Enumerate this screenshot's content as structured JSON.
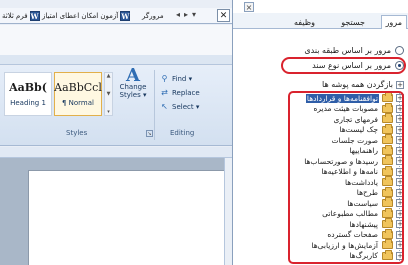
{
  "word": {
    "taskbar_tabs": [
      {
        "label": "فرم ثلاثة"
      },
      {
        "label": "آزمون امکان اعطای امتیاز"
      },
      {
        "label": "مرورگر"
      }
    ],
    "nav_arrows": [
      "◂",
      "▸",
      "▾"
    ],
    "close_label": "✕",
    "style_boxes": [
      {
        "sample": "AaBb(",
        "name": "Heading 1"
      },
      {
        "sample": "AaBbCcl",
        "name": "¶ Normal"
      }
    ],
    "change_styles": {
      "icon": "A",
      "line1": "Change",
      "line2": "Styles ▾"
    },
    "editing": {
      "find": "Find ▾",
      "replace": "Replace",
      "select": "Select ▾"
    },
    "group_labels": {
      "styles": "Styles",
      "editing": "Editing"
    }
  },
  "pane": {
    "close_label": "×",
    "tabs": [
      {
        "label": "مرور"
      },
      {
        "label": "جستجو"
      },
      {
        "label": "وظیفه"
      }
    ],
    "radio_options": [
      {
        "label": "مرور بر اساس طبقه بندی",
        "checked": false
      },
      {
        "label": "مرور بر اساس نوع سند",
        "checked": true
      }
    ],
    "tree_root": "بازگردن همه پوشه ها",
    "tree_items": [
      {
        "label": "توافقنامه‌ها و قراردادها",
        "selected": true
      },
      {
        "label": "مصوبات هیئت مدیره"
      },
      {
        "label": "فرمهای تجاری"
      },
      {
        "label": "چک لیست‌ها"
      },
      {
        "label": "صورت جلسات"
      },
      {
        "label": "راهنماییها"
      },
      {
        "label": "رسیدها و صورتحساب‌ها"
      },
      {
        "label": "نامه‌ها و اطلاعیه‌ها"
      },
      {
        "label": "یادداشت‌ها"
      },
      {
        "label": "طرح‌ها"
      },
      {
        "label": "سیاست‌ها"
      },
      {
        "label": "مطالب مطبوعاتی"
      },
      {
        "label": "پیشنهادها"
      },
      {
        "label": "صفحات گسترده"
      },
      {
        "label": "آزمایش‌ها و ارزیابی‌ها"
      },
      {
        "label": "کاربرگ‌ها"
      }
    ]
  }
}
